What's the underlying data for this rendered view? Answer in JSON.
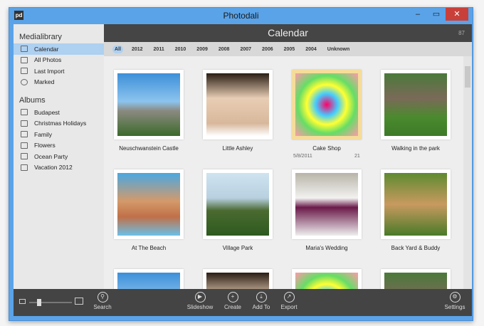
{
  "window": {
    "title": "Photodali",
    "logo": "pd"
  },
  "sidebar": {
    "medialibrary_title": "Medialibrary",
    "library": [
      {
        "label": "Calendar",
        "icon": "calendar-icon"
      },
      {
        "label": "All Photos",
        "icon": "photos-icon"
      },
      {
        "label": "Last Import",
        "icon": "import-icon"
      },
      {
        "label": "Marked",
        "icon": "marked-icon"
      }
    ],
    "albums_title": "Albums",
    "albums": [
      "Budapest",
      "Christmas Holidays",
      "Family",
      "Flowers",
      "Ocean Party",
      "Vacation 2012"
    ]
  },
  "header": {
    "title": "Calendar",
    "count": "87"
  },
  "years": [
    "All",
    "2012",
    "2011",
    "2010",
    "2009",
    "2008",
    "2007",
    "2006",
    "2005",
    "2004",
    "Unknown"
  ],
  "photos": [
    {
      "caption": "Neuschwanstein Castle"
    },
    {
      "caption": "Little Ashley"
    },
    {
      "caption": "Cake Shop",
      "date": "5/8/2011",
      "count": "21"
    },
    {
      "caption": "Walking in the park"
    },
    {
      "caption": "At The Beach"
    },
    {
      "caption": "Village Park"
    },
    {
      "caption": "Maria's Wedding"
    },
    {
      "caption": "Back Yard & Buddy"
    }
  ],
  "toolbar": {
    "search": "Search",
    "slideshow": "Slideshow",
    "create": "Create",
    "add_to": "Add To",
    "export": "Export",
    "settings": "Settings",
    "zoom_level": 0.2
  }
}
